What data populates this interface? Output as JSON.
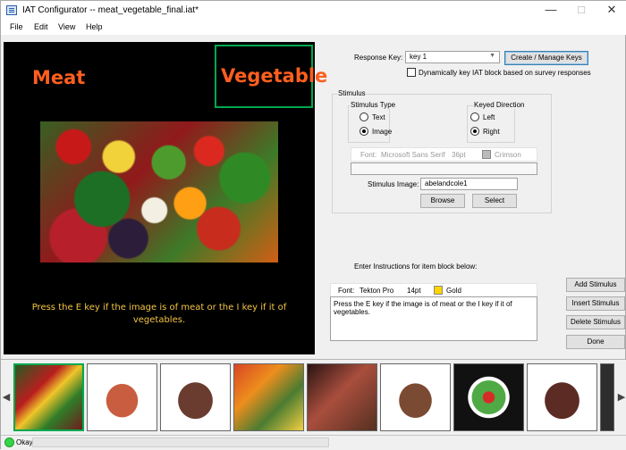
{
  "window": {
    "title": "IAT Configurator -- meat_vegetable_final.iat*",
    "minimize": "—",
    "maximize": "□",
    "close": "✕"
  },
  "menu": [
    "File",
    "Edit",
    "View",
    "Help"
  ],
  "preview": {
    "left_category": "Meat",
    "right_category": "Vegetable",
    "instruction": "Press the E key if the image is of meat or the I key if it of vegetables."
  },
  "response": {
    "label": "Response Key:",
    "selected": "key 1",
    "create_button": "Create / Manage Keys",
    "dynamic_label": "Dynamically key IAT block based on survey responses"
  },
  "stimulus": {
    "group_label": "Stimulus",
    "type_label": "Stimulus Type",
    "text_option": "Text",
    "image_option": "Image",
    "direction_label": "Keyed Direction",
    "left_option": "Left",
    "right_option": "Right",
    "font_prefix": "Font:",
    "font_name": "Microsoft Sans Serif",
    "font_size": "36pt",
    "font_color": "Crimson",
    "image_label": "Stimulus Image:",
    "image_value": "abelandcole1",
    "browse_button": "Browse",
    "select_button": "Select"
  },
  "instructions": {
    "label": "Enter Instructions for item block below:",
    "font_prefix": "Font:",
    "font_name": "Tekton Pro",
    "font_size": "14pt",
    "font_color": "Gold",
    "text": "Press the E key if the image is of meat or the I key if it of vegetables."
  },
  "actions": [
    "Add Stimulus",
    "Insert Stimulus",
    "Delete Stimulus",
    "Done"
  ],
  "status": {
    "text": "Okay",
    "progress": 0
  },
  "colors": {
    "green": "#00a84f",
    "orange": "#ff5f1f",
    "gold": "#f4c542",
    "crimson": "#dc143c"
  }
}
